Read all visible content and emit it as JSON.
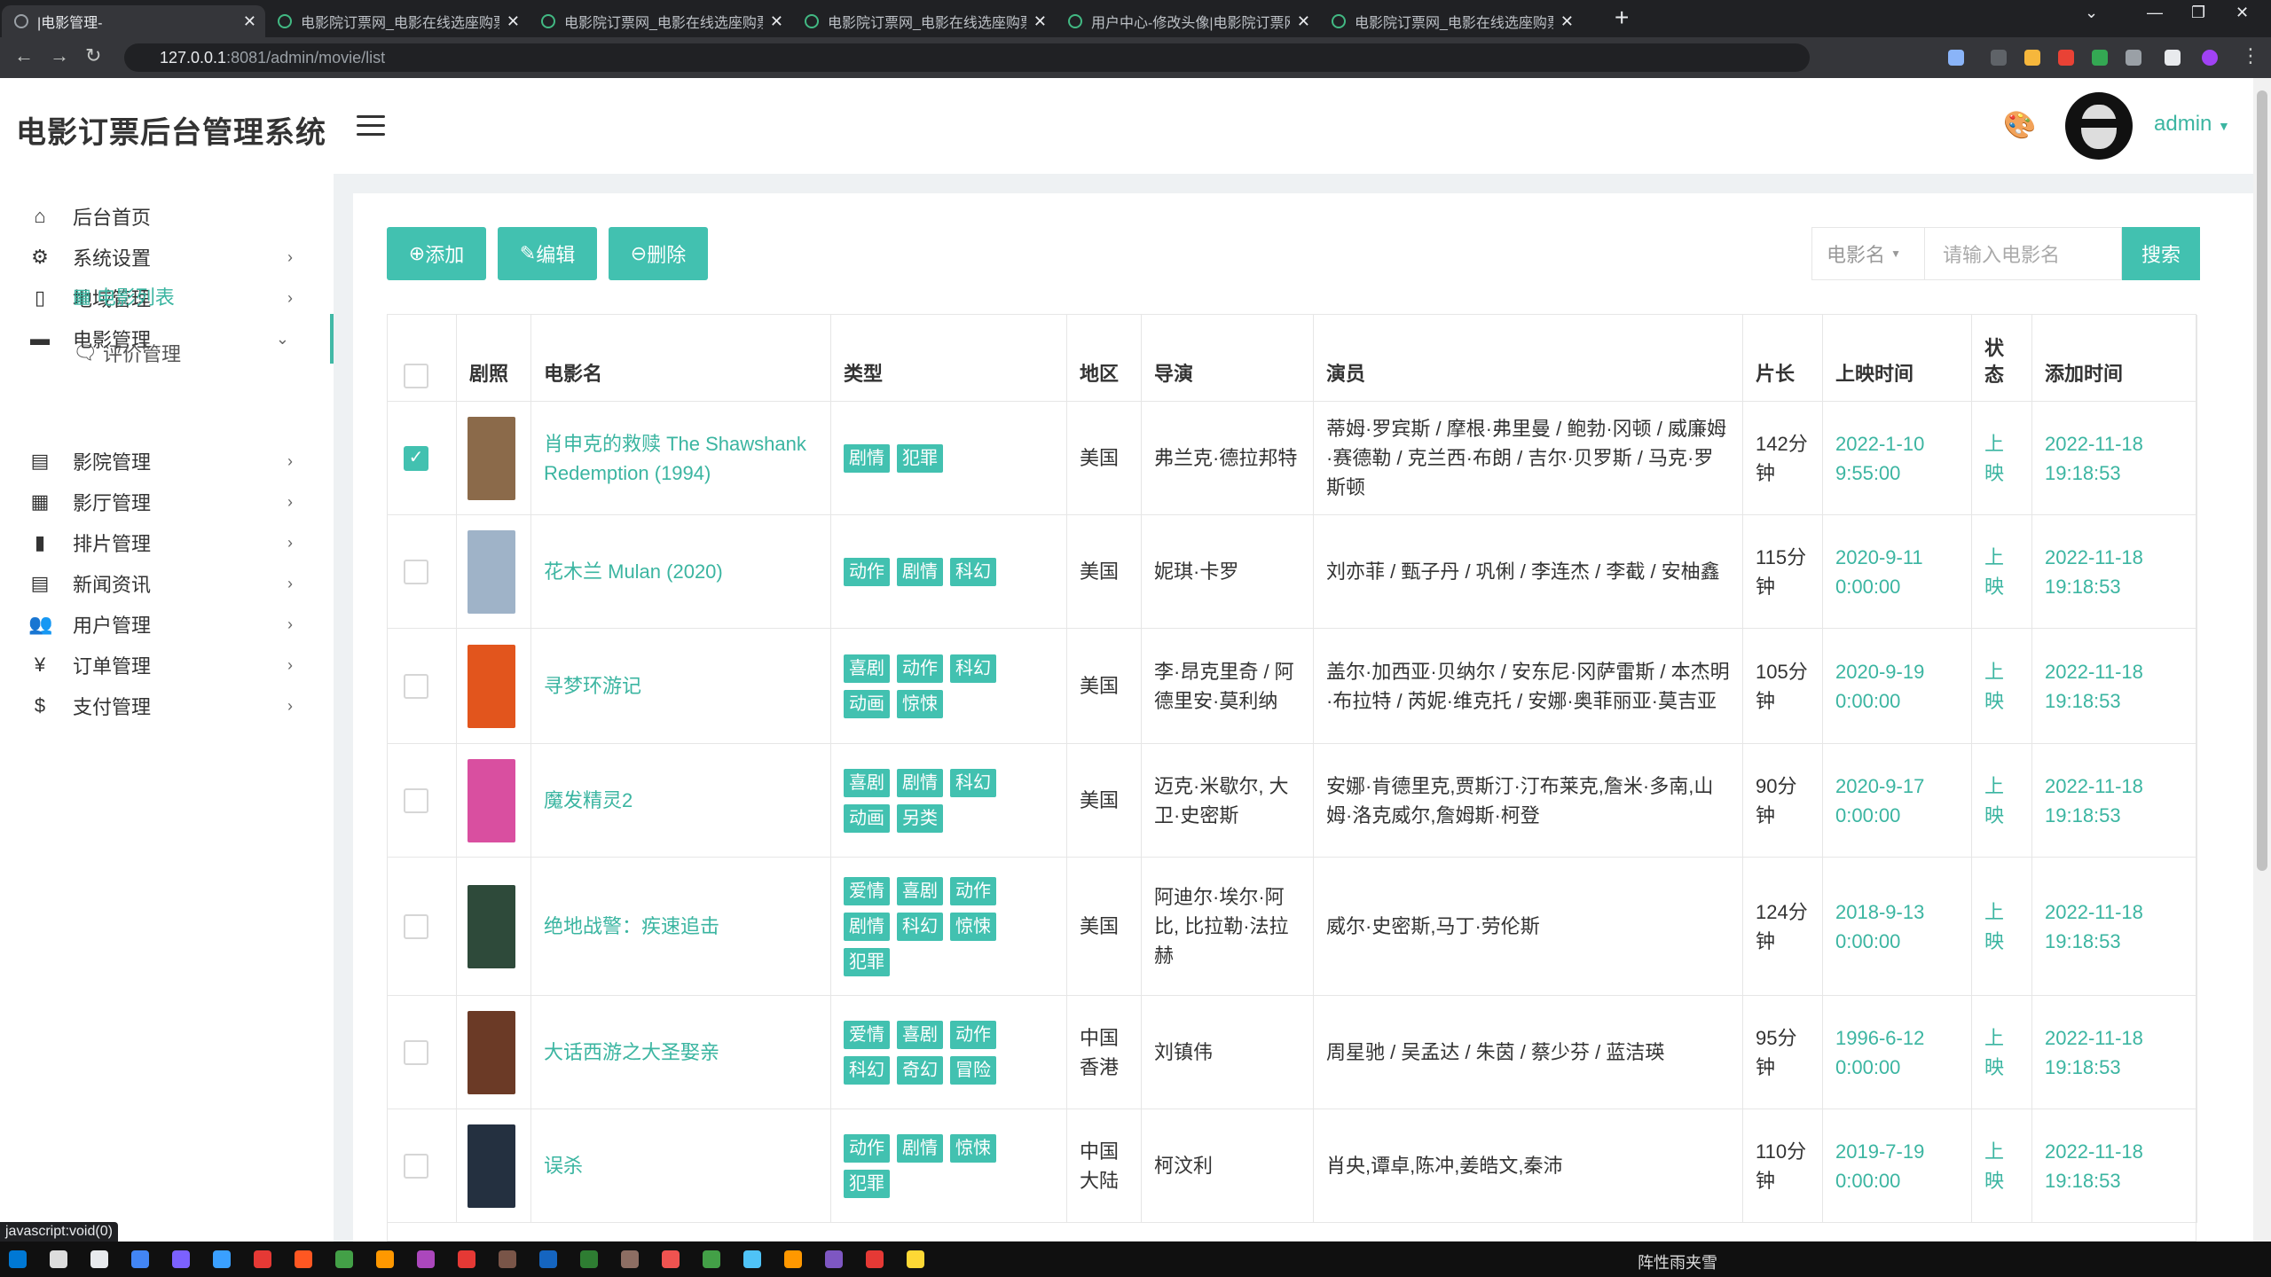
{
  "browser": {
    "tabs": [
      {
        "title": "|电影管理-",
        "active": true
      },
      {
        "title": "电影院订票网_电影在线选座购票",
        "active": false
      },
      {
        "title": "电影院订票网_电影在线选座购票",
        "active": false
      },
      {
        "title": "电影院订票网_电影在线选座购票",
        "active": false
      },
      {
        "title": "用户中心-修改头像|电影院订票网",
        "active": false
      },
      {
        "title": "电影院订票网_电影在线选座购票",
        "active": false
      }
    ],
    "url_host": "127.0.0.1",
    "url_path": ":8081/admin/movie/list",
    "status_text": "javascript:void(0)"
  },
  "header": {
    "logo": "电影订票后台管理系统",
    "username": "admin"
  },
  "sidebar": {
    "items": [
      {
        "label": "后台首页",
        "icon": "home-icon"
      },
      {
        "label": "系统设置",
        "icon": "gear-icon"
      },
      {
        "label": "地域管理",
        "icon": "map-icon"
      },
      {
        "label": "电影管理",
        "icon": "film-icon"
      },
      {
        "label": "影院管理",
        "icon": "cinema-icon"
      },
      {
        "label": "影厅管理",
        "icon": "hall-icon"
      },
      {
        "label": "排片管理",
        "icon": "schedule-icon"
      },
      {
        "label": "新闻资讯",
        "icon": "news-icon"
      },
      {
        "label": "用户管理",
        "icon": "users-icon"
      },
      {
        "label": "订单管理",
        "icon": "yen-icon"
      },
      {
        "label": "支付管理",
        "icon": "dollar-icon"
      }
    ],
    "sub_items": [
      {
        "label": "电影列表",
        "active": true
      },
      {
        "label": "评价管理",
        "active": false
      }
    ]
  },
  "toolbar": {
    "add": "添加",
    "edit": "编辑",
    "delete": "删除",
    "search_field": "电影名",
    "search_placeholder": "请输入电影名",
    "search_button": "搜索"
  },
  "table": {
    "headers": [
      "剧照",
      "电影名",
      "类型",
      "地区",
      "导演",
      "演员",
      "片长",
      "上映时间",
      "状态",
      "添加时间"
    ],
    "rows": [
      {
        "checked": true,
        "poster_color": "#8b6a4a",
        "name": "肖申克的救赎 The Shawshank Redemption (1994)",
        "types": [
          "剧情",
          "犯罪"
        ],
        "region": "美国",
        "director": "弗兰克·德拉邦特",
        "actors": "蒂姆·罗宾斯 / 摩根·弗里曼 / 鲍勃·冈顿 / 威廉姆·赛德勒 / 克兰西·布朗 / 吉尔·贝罗斯 / 马克·罗斯顿",
        "duration": "142分钟",
        "release": "2022-1-10 9:55:00",
        "status": "上映",
        "added": "2022-11-18 19:18:53"
      },
      {
        "checked": false,
        "poster_color": "#9fb3c8",
        "name": "花木兰 Mulan (2020)",
        "types": [
          "动作",
          "剧情",
          "科幻"
        ],
        "region": "美国",
        "director": "妮琪·卡罗",
        "actors": "刘亦菲 / 甄子丹 / 巩俐 / 李连杰 / 李截 / 安柚鑫",
        "duration": "115分钟",
        "release": "2020-9-11 0:00:00",
        "status": "上映",
        "added": "2022-11-18 19:18:53"
      },
      {
        "checked": false,
        "poster_color": "#e2551d",
        "name": "寻梦环游记",
        "types": [
          "喜剧",
          "动作",
          "科幻",
          "动画",
          "惊悚"
        ],
        "region": "美国",
        "director": "李·昂克里奇 / 阿德里安·莫利纳",
        "actors": "盖尔·加西亚·贝纳尔 / 安东尼·冈萨雷斯 / 本杰明·布拉特 / 芮妮·维克托 / 安娜·奥菲丽亚·莫吉亚",
        "duration": "105分钟",
        "release": "2020-9-19 0:00:00",
        "status": "上映",
        "added": "2022-11-18 19:18:53"
      },
      {
        "checked": false,
        "poster_color": "#d94fa0",
        "name": "魔发精灵2",
        "types": [
          "喜剧",
          "剧情",
          "科幻",
          "动画",
          "另类"
        ],
        "region": "美国",
        "director": "迈克·米歇尔, 大卫·史密斯",
        "actors": "安娜·肯德里克,贾斯汀·汀布莱克,詹米·多南,山姆·洛克威尔,詹姆斯·柯登",
        "duration": "90分钟",
        "release": "2020-9-17 0:00:00",
        "status": "上映",
        "added": "2022-11-18 19:18:53"
      },
      {
        "checked": false,
        "poster_color": "#2e4a3a",
        "name": "绝地战警：疾速追击",
        "types": [
          "爱情",
          "喜剧",
          "动作",
          "剧情",
          "科幻",
          "惊悚",
          "犯罪"
        ],
        "region": "美国",
        "director": "阿迪尔·埃尔·阿比, 比拉勒·法拉赫",
        "actors": "威尔·史密斯,马丁·劳伦斯",
        "duration": "124分钟",
        "release": "2018-9-13 0:00:00",
        "status": "上映",
        "added": "2022-11-18 19:18:53"
      },
      {
        "checked": false,
        "poster_color": "#6b3a26",
        "name": "大话西游之大圣娶亲",
        "types": [
          "爱情",
          "喜剧",
          "动作",
          "科幻",
          "奇幻",
          "冒险"
        ],
        "region": "中国香港",
        "director": "刘镇伟",
        "actors": "周星驰 / 吴孟达 / 朱茵 / 蔡少芬 / 蓝洁瑛",
        "duration": "95分钟",
        "release": "1996-6-12 0:00:00",
        "status": "上映",
        "added": "2022-11-18 19:18:53"
      },
      {
        "checked": false,
        "poster_color": "#243040",
        "name": "误杀",
        "types": [
          "动作",
          "剧情",
          "惊悚",
          "犯罪"
        ],
        "region": "中国大陆",
        "director": "柯汶利",
        "actors": "肖央,谭卓,陈冲,姜皓文,秦沛",
        "duration": "110分钟",
        "release": "2019-7-19 0:00:00",
        "status": "上映",
        "added": "2022-11-18 19:18:53"
      }
    ]
  },
  "taskbar": {
    "weather": "阵性雨夹雪"
  }
}
